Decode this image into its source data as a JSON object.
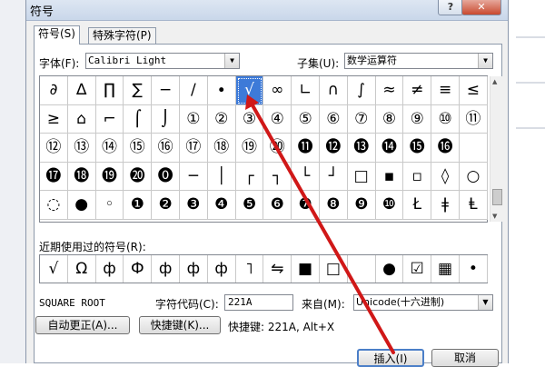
{
  "window": {
    "title": "符号",
    "help": "?",
    "close": "✕"
  },
  "tabs": [
    {
      "label": "符号(S)"
    },
    {
      "label": "特殊字符(P)"
    }
  ],
  "font": {
    "label": "字体(F):",
    "value": "Calibri Light"
  },
  "subset": {
    "label": "子集(U):",
    "value": "数学运算符"
  },
  "grid": [
    [
      "∂",
      "∆",
      "∏",
      "∑",
      "−",
      "∕",
      "∙",
      "√",
      "∞",
      "∟",
      "∩",
      "∫",
      "≈",
      "≠",
      "≡",
      "≤"
    ],
    [
      "≥",
      "⌂",
      "⌐",
      "⌠",
      "⌡",
      "①",
      "②",
      "③",
      "④",
      "⑤",
      "⑥",
      "⑦",
      "⑧",
      "⑨",
      "⑩",
      "⑪"
    ],
    [
      "⑫",
      "⑬",
      "⑭",
      "⑮",
      "⑯",
      "⑰",
      "⑱",
      "⑲",
      "⑳",
      "⓫",
      "⓬",
      "⓭",
      "⓮",
      "⓯",
      "⓰",
      ""
    ],
    [
      "⓱",
      "⓲",
      "⓳",
      "⓴",
      "⓿",
      "─",
      "│",
      "┌",
      "┐",
      "└",
      "┘",
      "□",
      "▪",
      "▫",
      "◊",
      "○"
    ],
    [
      "◌",
      "●",
      "◦",
      "❶",
      "❷",
      "❸",
      "❹",
      "❺",
      "❻",
      "❼",
      "❽",
      "❾",
      "❿",
      "Ł",
      "ǂ",
      "Ⱡ"
    ]
  ],
  "selected_symbol": "√",
  "recent": {
    "label": "近期使用过的符号(R):",
    "items": [
      "√",
      "Ω",
      "ф",
      "Ф",
      "ф",
      "ф",
      "ф",
      "˥",
      "⇋",
      "■",
      "□",
      "",
      "●",
      "☑",
      "▦",
      "•"
    ]
  },
  "char_name": "SQUARE ROOT",
  "char_code": {
    "label": "字符代码(C):",
    "value": "221A"
  },
  "from": {
    "label": "来自(M):",
    "value": "Unicode(十六进制)"
  },
  "buttons": {
    "autocorrect": "自动更正(A)...",
    "shortcut": "快捷键(K)...",
    "insert": "插入(I)",
    "cancel": "取消"
  },
  "shortcut_text": "快捷键: 221A, Alt+X",
  "accent_colors": {
    "selection": "#3d7ad8",
    "arrow": "#d01818"
  }
}
